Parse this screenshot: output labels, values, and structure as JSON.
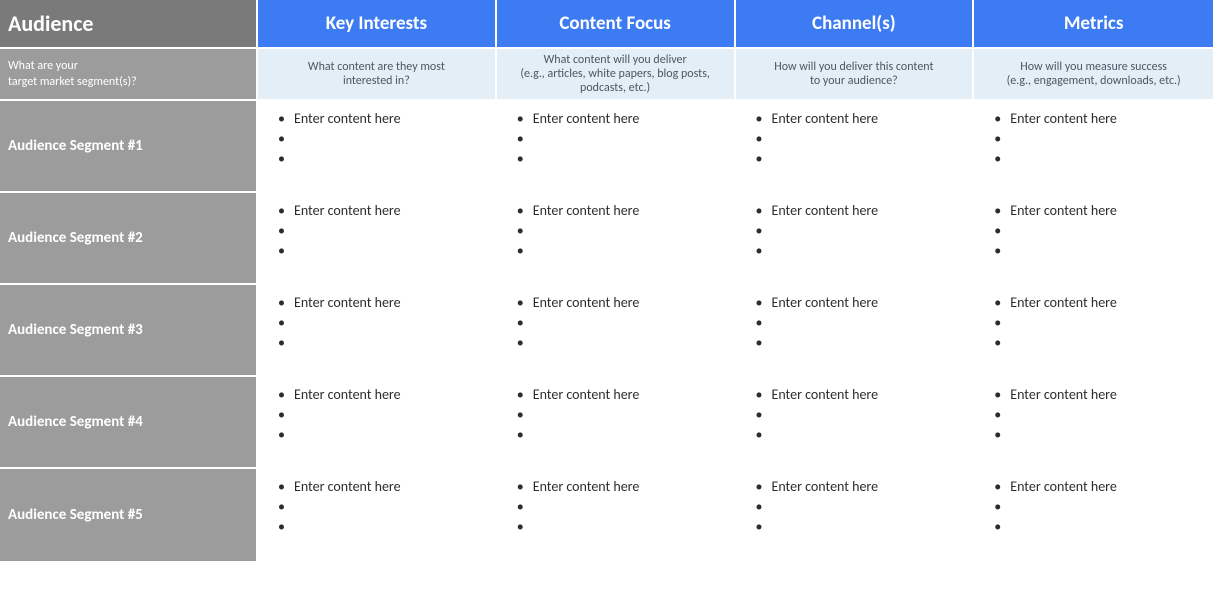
{
  "header": {
    "audience": "Audience",
    "cols": [
      "Key Interests",
      "Content Focus",
      "Channel(s)",
      "Metrics"
    ]
  },
  "subheader": {
    "left": "What are your\ntarget market segment(s)?",
    "cols": [
      "What content are they most\ninterested in?",
      "What content will you deliver\n(e.g., articles, white papers, blog posts,\npodcasts, etc.)",
      "How will you deliver this content\nto your audience?",
      "How will you measure success\n(e.g., engagement, downloads, etc.)"
    ]
  },
  "rows": [
    {
      "label": "Audience Segment #1",
      "cells": [
        [
          "Enter content here",
          "",
          ""
        ],
        [
          "Enter content here",
          "",
          ""
        ],
        [
          "Enter content here",
          "",
          ""
        ],
        [
          "Enter content here",
          "",
          ""
        ]
      ]
    },
    {
      "label": "Audience Segment #2",
      "cells": [
        [
          "Enter content here",
          "",
          ""
        ],
        [
          "Enter content here",
          "",
          ""
        ],
        [
          "Enter content here",
          "",
          ""
        ],
        [
          "Enter content here",
          "",
          ""
        ]
      ]
    },
    {
      "label": "Audience Segment #3",
      "cells": [
        [
          "Enter content here",
          "",
          ""
        ],
        [
          "Enter content here",
          "",
          ""
        ],
        [
          "Enter content here",
          "",
          ""
        ],
        [
          "Enter content here",
          "",
          ""
        ]
      ]
    },
    {
      "label": "Audience Segment #4",
      "cells": [
        [
          "Enter content here",
          "",
          ""
        ],
        [
          "Enter content here",
          "",
          ""
        ],
        [
          "Enter content here",
          "",
          ""
        ],
        [
          "Enter content here",
          "",
          ""
        ]
      ]
    },
    {
      "label": "Audience Segment #5",
      "cells": [
        [
          "Enter content here",
          "",
          ""
        ],
        [
          "Enter content here",
          "",
          ""
        ],
        [
          "Enter content here",
          "",
          ""
        ],
        [
          "Enter content here",
          "",
          ""
        ]
      ]
    }
  ]
}
